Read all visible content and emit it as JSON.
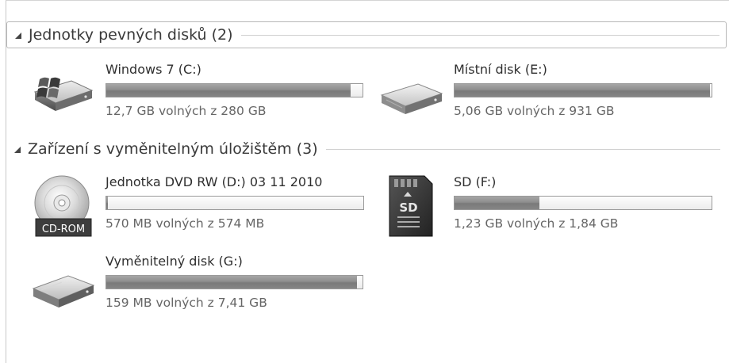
{
  "groups": [
    {
      "title": "Jednotky pevných disků (2)",
      "drives": [
        {
          "name": "Windows 7 (C:)",
          "free": "12,7 GB volných z 280 GB",
          "used_fraction": 0.955,
          "icon": "windows-hard-drive-icon"
        },
        {
          "name": "Místní disk (E:)",
          "free": "5,06 GB volných z 931 GB",
          "used_fraction": 0.995,
          "icon": "hard-drive-icon"
        }
      ]
    },
    {
      "title": "Zařízení s vyměnitelným úložištěm (3)",
      "drives": [
        {
          "name": "Jednotka DVD RW (D:) 03 11 2010",
          "free": "570 MB volných z 574 MB",
          "used_fraction": 0.007,
          "icon": "cd-rom-icon",
          "icon_label": "CD-ROM"
        },
        {
          "name": "SD (F:)",
          "free": "1,23 GB volných z 1,84 GB",
          "used_fraction": 0.33,
          "icon": "sd-card-icon",
          "icon_label": "SD"
        },
        {
          "name": "Vyměnitelný disk (G:)",
          "free": "159 MB volných z 7,41 GB",
          "used_fraction": 0.979,
          "icon": "removable-disk-icon"
        }
      ]
    }
  ]
}
